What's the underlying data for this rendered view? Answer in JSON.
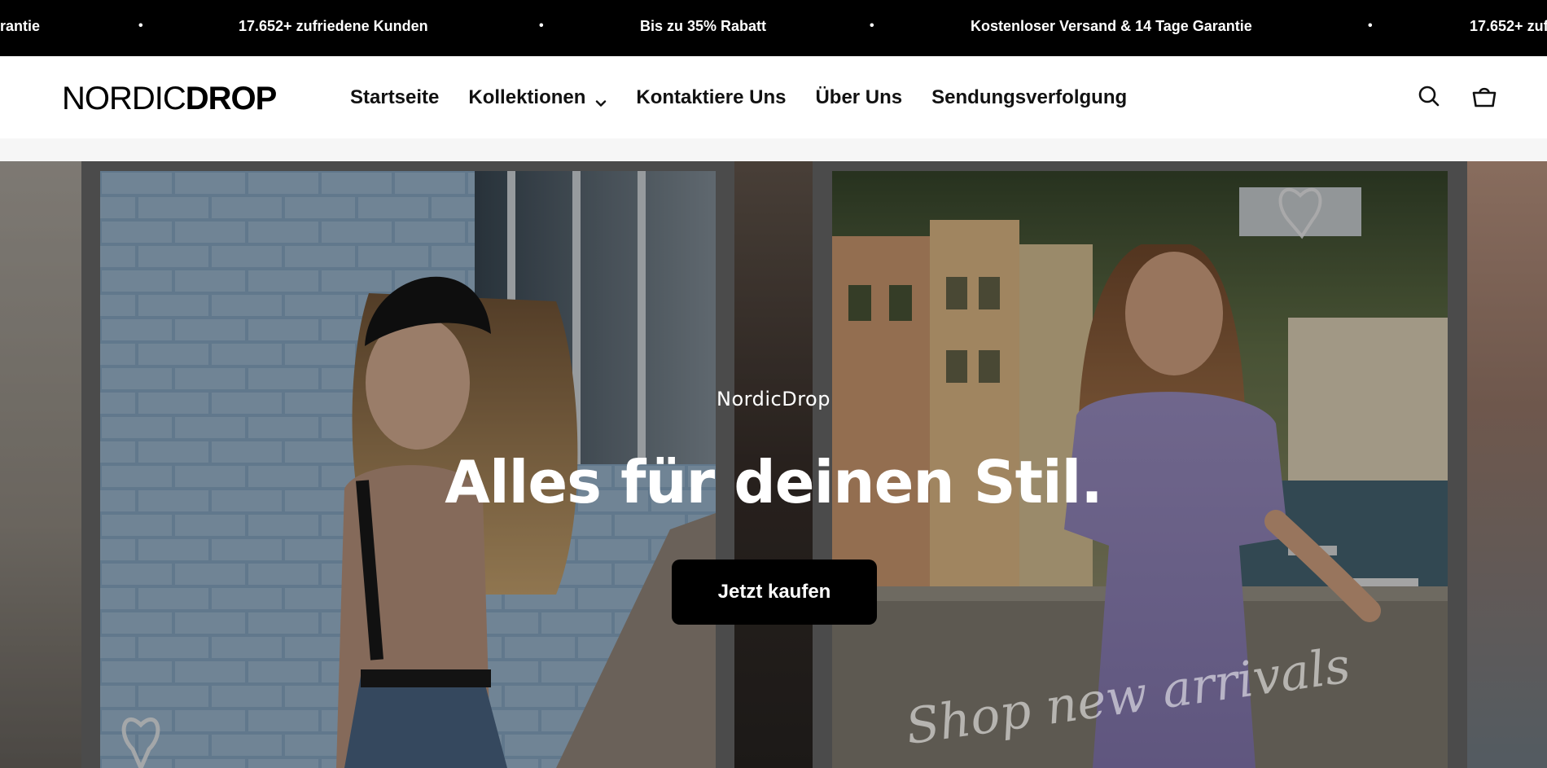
{
  "announcement": {
    "items": [
      "rantie",
      "17.652+ zufriedene Kunden",
      "Bis zu 35% Rabatt",
      "Kostenloser Versand & 14 Tage Garantie",
      "17.652+ zufrie"
    ],
    "separator": "•"
  },
  "header": {
    "logo_light": "NORDIC",
    "logo_bold": "DROP",
    "nav": [
      {
        "label": "Startseite"
      },
      {
        "label": "Kollektionen",
        "has_dropdown": true
      },
      {
        "label": "Kontaktiere Uns"
      },
      {
        "label": "Über Uns"
      },
      {
        "label": "Sendungsverfolgung"
      }
    ],
    "icons": [
      "search-icon",
      "cart-icon"
    ]
  },
  "hero": {
    "eyebrow": "NordicDrop",
    "title": "Alles für deinen Stil.",
    "button_label": "Jetzt kaufen",
    "script_text": "Shop new arrivals"
  },
  "colors": {
    "announcement_bg": "#000000",
    "button_bg": "#000000",
    "text_dark": "#111111"
  }
}
